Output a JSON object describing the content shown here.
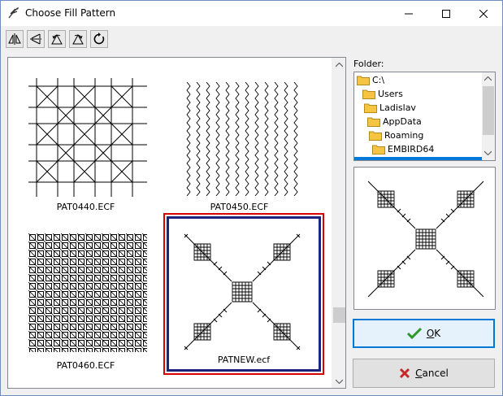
{
  "window": {
    "title": "Choose Fill Pattern",
    "controls": [
      "minimize",
      "maximize",
      "close"
    ]
  },
  "toolbar": {
    "tools": [
      "mirror-horizontal-icon",
      "mirror-vertical-icon",
      "rotate-left-icon",
      "rotate-right-icon",
      "rotate-icon"
    ]
  },
  "gallery": {
    "items": [
      {
        "label": "PAT0440.ECF",
        "selected": false
      },
      {
        "label": "PAT0450.ECF",
        "selected": false
      },
      {
        "label": "PAT0460.ECF",
        "selected": false
      },
      {
        "label": "PATNEW.ecf",
        "selected": true
      }
    ]
  },
  "folder": {
    "label": "Folder:",
    "tree": [
      {
        "label": "C:\\",
        "depth": 0
      },
      {
        "label": "Users",
        "depth": 1
      },
      {
        "label": "Ladislav",
        "depth": 2
      },
      {
        "label": "AppData",
        "depth": 3
      },
      {
        "label": "Roaming",
        "depth": 4
      },
      {
        "label": "EMBIRD64",
        "depth": 5
      }
    ]
  },
  "buttons": {
    "ok_label": "OK",
    "ok_underline": "O",
    "ok_rest": "K",
    "cancel_underline": "C",
    "cancel_rest": "ancel"
  },
  "colors": {
    "selected_outer": "#d60000",
    "selected_inner": "#1a237e",
    "accent": "#0078d7",
    "ok_check": "#2e9a2e",
    "cancel_x": "#c62828",
    "folder": "#f5c542"
  }
}
